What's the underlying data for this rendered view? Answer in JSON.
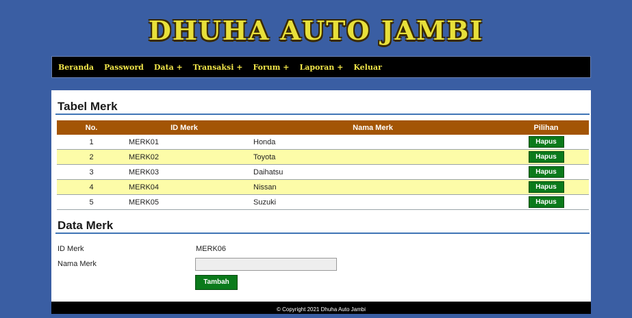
{
  "header": {
    "site_title": "DHUHA AUTO JAMBI"
  },
  "nav": {
    "items": [
      {
        "label": "Beranda"
      },
      {
        "label": "Password"
      },
      {
        "label": "Data +"
      },
      {
        "label": "Transaksi +"
      },
      {
        "label": "Forum +"
      },
      {
        "label": "Laporan +"
      },
      {
        "label": "Keluar"
      }
    ]
  },
  "table_section": {
    "title": "Tabel Merk",
    "columns": [
      "No.",
      "ID Merk",
      "Nama Merk",
      "Pilihan"
    ],
    "rows": [
      {
        "no": "1",
        "id": "MERK01",
        "nama": "Honda",
        "action": "Hapus"
      },
      {
        "no": "2",
        "id": "MERK02",
        "nama": "Toyota",
        "action": "Hapus"
      },
      {
        "no": "3",
        "id": "MERK03",
        "nama": "Daihatsu",
        "action": "Hapus"
      },
      {
        "no": "4",
        "id": "MERK04",
        "nama": "Nissan",
        "action": "Hapus"
      },
      {
        "no": "5",
        "id": "MERK05",
        "nama": "Suzuki",
        "action": "Hapus"
      }
    ]
  },
  "form_section": {
    "title": "Data Merk",
    "id_label": "ID Merk",
    "id_value": "MERK06",
    "nama_label": "Nama Merk",
    "nama_value": "",
    "submit_label": "Tambah"
  },
  "footer": {
    "text": "© Copyright 2021 Dhuha Auto Jambi"
  },
  "colors": {
    "background": "#3a5ea3",
    "title": "#e8e03a",
    "nav_background": "#000000",
    "nav_text": "#f2e64a",
    "table_header": "#a35505",
    "row_alt": "#fdfca8",
    "button": "#0b7a1b",
    "section_line": "#3f74b5"
  }
}
